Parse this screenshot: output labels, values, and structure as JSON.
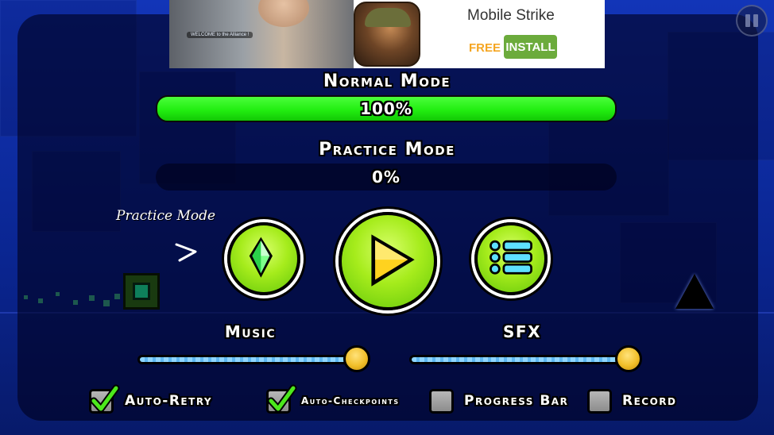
{
  "ad": {
    "chat_text": "WELCOME to the Alliance !",
    "app_title": "Mobile Strike",
    "price": "FREE",
    "install_label": "INSTALL"
  },
  "normal_mode": {
    "label": "Normal Mode",
    "progress_text": "100%",
    "progress": 1.0
  },
  "practice_mode": {
    "label": "Practice Mode",
    "progress_text": "0%",
    "progress": 0.0
  },
  "practice_hint": "Practice Mode",
  "buttons": {
    "practice_icon": "green-diamond-icon",
    "play_icon": "play-triangle-icon",
    "menu_icon": "list-menu-icon"
  },
  "volume": {
    "music_label": "Music",
    "music_level": 0.95,
    "sfx_label": "SFX",
    "sfx_level": 0.95
  },
  "options": [
    {
      "label": "Auto-Retry",
      "checked": true
    },
    {
      "label": "Auto-Checkpoints",
      "checked": true
    },
    {
      "label": "Progress Bar",
      "checked": false
    },
    {
      "label": "Record",
      "checked": false
    }
  ],
  "colors": {
    "progress_green": "#22ee11",
    "button_green": "#a6ec1c",
    "knob_yellow": "#f1bf2a",
    "background_blue": "#0d2a9a"
  }
}
